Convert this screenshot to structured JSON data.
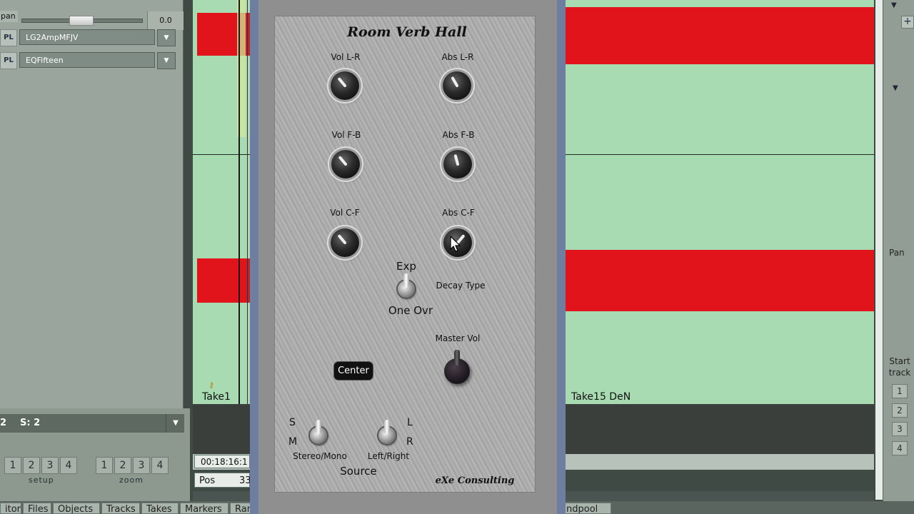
{
  "left_panel": {
    "pan_label": "pan",
    "pan_value": "0.0",
    "plugins": [
      {
        "tag": "PL",
        "name": "LG2AmpMFJV"
      },
      {
        "tag": "PL",
        "name": "EQFifteen"
      }
    ]
  },
  "selector": {
    "left_value": "2",
    "text": "S: 2"
  },
  "groups": {
    "setup": {
      "label": "setup",
      "buttons": [
        "1",
        "2",
        "3",
        "4"
      ]
    },
    "zoom": {
      "label": "zoom",
      "buttons": [
        "1",
        "2",
        "3",
        "4"
      ]
    }
  },
  "timeline": {
    "take_left": "Take1",
    "take_right": "Take15  DeN",
    "time": "00:18:16:1",
    "pos_label": "Pos",
    "pos_value": "33"
  },
  "plugin": {
    "title": "Room Verb Hall",
    "knobs": [
      {
        "label": "Vol L-R"
      },
      {
        "label": "Abs L-R"
      },
      {
        "label": "Vol F-B"
      },
      {
        "label": "Abs F-B"
      },
      {
        "label": "Vol C-F"
      },
      {
        "label": "Abs C-F"
      }
    ],
    "decay": {
      "top": "Exp",
      "bottom": "One Ovr",
      "label": "Decay Type"
    },
    "master_label": "Master Vol",
    "center_button": "Center",
    "stereo_mono": {
      "top": "S",
      "bottom": "M",
      "label": "Stereo/Mono"
    },
    "left_right": {
      "top": "L",
      "bottom": "R",
      "label": "Left/Right"
    },
    "source_label": "Source",
    "vendor": "eXe Consulting"
  },
  "right_panel": {
    "pan_label": "Pan",
    "start_track_label": "Start track",
    "buttons": [
      "1",
      "2",
      "3",
      "4"
    ]
  },
  "tabs": [
    "itor",
    "Files",
    "Objects",
    "Tracks",
    "Takes",
    "Markers",
    "Ran",
    "ndpool"
  ],
  "colors": {
    "waveform": "#e1141c",
    "track_bg": "#a9dbb2",
    "plugin_frame": "#6d7ea1"
  }
}
